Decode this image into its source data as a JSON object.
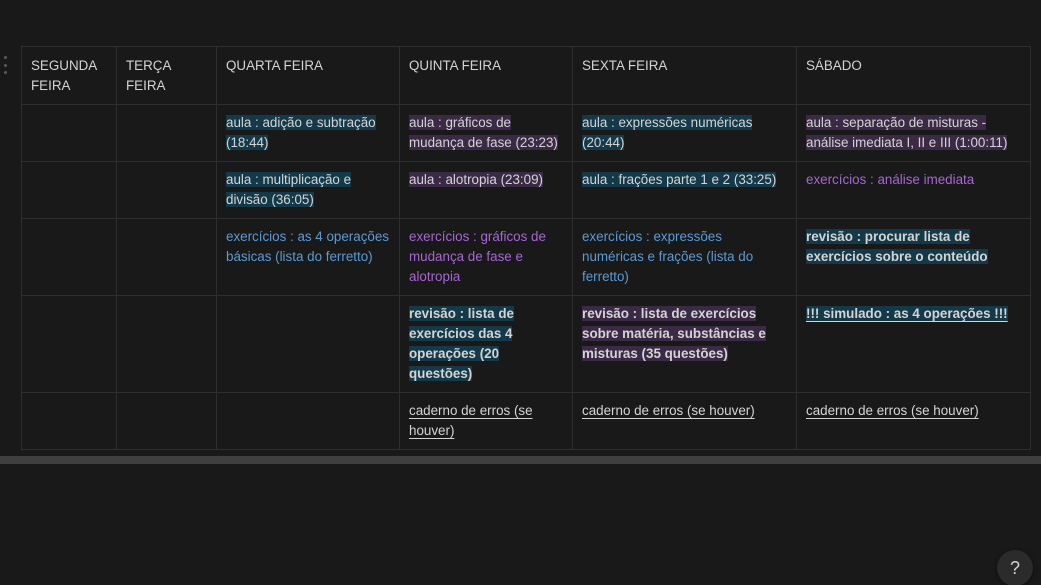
{
  "headers": [
    "SEGUNDA FEIRA",
    "TERÇA FEIRA",
    "QUARTA FEIRA",
    "QUINTA FEIRA",
    "SEXTA FEIRA",
    "SÁBADO"
  ],
  "rows": [
    {
      "quarta": "aula : adição e subtração (18:44)",
      "quinta": "aula : gráficos de mudança de fase (23:23)",
      "sexta": "aula : expressões numéricas (20:44)",
      "sabado": "aula : separação de misturas - análise imediata I, II e III (1:00:11)"
    },
    {
      "quarta": "aula : multiplicação e divisão (36:05)",
      "quinta": "aula :  alotropia (23:09)",
      "sexta": "aula : frações parte 1 e 2 (33:25)",
      "sabado": "exercícios : análise imediata"
    },
    {
      "quarta": "exercícios : as 4 operações básicas (lista do ferretto)",
      "quinta": "exercícios : gráficos de mudança de fase e alotropia",
      "sexta": "exercícios : expressões numéricas e frações (lista do ferretto)",
      "sabado": "revisão : procurar lista de exercícios sobre o conteúdo"
    },
    {
      "quinta": "revisão : lista de exercícios das 4 operações (20 questões)",
      "sexta": "revisão : lista de exercícios sobre matéria, substâncias e misturas (35 questões)",
      "sabado": "!!! simulado : as 4 operações !!!"
    },
    {
      "quinta": "caderno de erros (se houver)",
      "sexta": "caderno de erros (se houver)",
      "sabado": "caderno de erros (se houver)"
    }
  ],
  "help_label": "?",
  "colors": {
    "background": "#191919",
    "highlight_blue": "#143a4a",
    "highlight_purple": "#3b2a45",
    "text_blue": "#5a9bd5",
    "text_purple": "#a766d4"
  }
}
